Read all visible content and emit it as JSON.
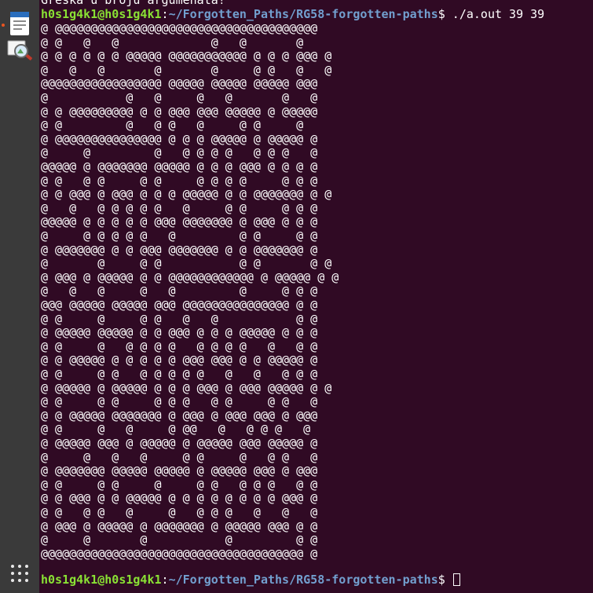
{
  "dock": {
    "items": [
      {
        "name": "libreoffice-writer",
        "icon": "document-icon"
      },
      {
        "name": "image-viewer",
        "icon": "photo-magnifier-icon"
      },
      {
        "name": "show-applications",
        "icon": "grid-icon"
      }
    ],
    "accent": "#e95420"
  },
  "terminal": {
    "colors": {
      "background": "#300a24",
      "user": "#8ae234",
      "path": "#729fcf",
      "text": "#ffffff"
    },
    "error_line": "Greška u broju argumenata!",
    "prompt1": {
      "user_host": "h0s1g4k1@h0s1g4k1",
      "sep": ":",
      "path": "~/Forgotten_Paths/RG58-forgotten-paths",
      "symbol": "$",
      "command": " ./a.out 39 39"
    },
    "maze": [
      "@ @@@@@@@@@@@@@@@@@@@@@@@@@@@@@@@@@@@@@",
      "@ @   @   @             @   @       @",
      "@ @ @ @ @ @ @@@@@ @@@@@@@@@@@ @ @ @ @@@ @",
      "@   @   @       @       @     @ @   @   @",
      "@@@@@@@@@@@@@@@@@ @@@@@ @@@@@ @@@@@ @@@",
      "@           @   @     @   @       @   @",
      "@ @ @@@@@@@@@ @ @ @@@ @@@ @@@@@ @ @@@@@",
      "@ @         @   @ @   @     @ @     @",
      "@ @@@@@@@@@@@@@@@ @ @ @ @@@@@ @ @@@@@ @",
      "@     @         @   @ @ @ @   @ @ @   @",
      "@@@@@ @ @@@@@@@ @@@@@ @ @ @ @@@ @ @ @ @",
      "@ @   @ @     @ @     @ @ @ @     @ @ @",
      "@ @ @@@ @ @@@ @ @ @ @@@@@ @ @ @@@@@@@ @ @",
      "@   @   @ @ @ @ @   @     @ @     @ @ @",
      "@@@@@ @ @ @ @ @ @@@ @@@@@@@ @ @@@ @ @ @",
      "@     @ @ @ @ @   @         @ @     @ @",
      "@ @@@@@@@ @ @ @@@ @@@@@@@ @ @ @@@@@@@ @",
      "@       @     @ @           @ @       @ @",
      "@ @@@ @ @@@@@ @ @ @@@@@@@@@@@@ @ @@@@@ @ @",
      "@   @   @     @   @         @     @ @ @",
      "@@@ @@@@@ @@@@@ @@@ @@@@@@@@@@@@@@@ @ @",
      "@ @     @     @ @   @   @           @ @",
      "@ @@@@@ @@@@@ @ @ @@@ @ @ @ @@@@@ @ @ @",
      "@ @     @   @ @ @ @   @ @ @ @   @   @ @",
      "@ @ @@@@@ @ @ @ @ @ @@@ @@@ @ @ @@@@@ @",
      "@ @     @ @   @ @ @ @ @   @   @   @ @ @",
      "@ @@@@@ @ @@@@@ @ @ @ @@@ @ @@@ @@@@@ @ @",
      "@ @     @ @     @ @ @   @ @     @ @   @",
      "@ @ @@@@@ @@@@@@@ @ @@@ @ @@@ @@@ @ @@@",
      "@ @     @   @     @ @@   @   @ @ @   @",
      "@ @@@@@ @@@ @ @@@@@ @ @@@@@ @@@ @@@@@ @",
      "@     @   @   @     @ @     @   @ @   @",
      "@ @@@@@@@ @@@@@ @@@@@ @ @@@@@ @@@ @ @@@",
      "@ @     @ @     @     @ @   @ @ @   @ @",
      "@ @ @@@ @ @ @@@@@ @ @ @ @ @ @ @ @ @@@ @",
      "@ @   @ @   @     @   @ @ @   @   @   @",
      "@ @@@ @ @@@@@ @ @@@@@@@ @ @@@@@ @@@ @ @",
      "@     @       @           @         @ @",
      "@@@@@@@@@@@@@@@@@@@@@@@@@@@@@@@@@@@@@ @"
    ],
    "prompt2": {
      "user_host": "h0s1g4k1@h0s1g4k1",
      "sep": ":",
      "path": "~/Forgotten_Paths/RG58-forgotten-paths",
      "symbol": "$",
      "command": " "
    }
  }
}
